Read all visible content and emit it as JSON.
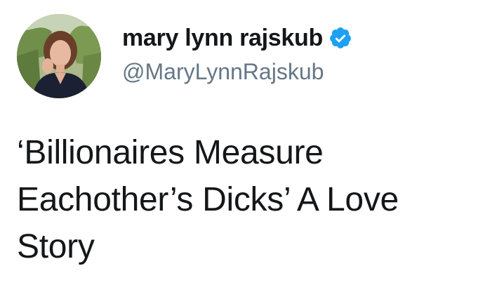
{
  "tweet": {
    "author": {
      "display_name": "mary lynn rajskub",
      "handle": "@MaryLynnRajskub",
      "verified": true
    },
    "text": "‘Billionaires Measure Eachother’s Dicks’ A Love Story"
  },
  "icons": {
    "avatar": "profile-photo",
    "verified": "verified-badge-icon"
  },
  "colors": {
    "text_primary": "#14171a",
    "text_secondary": "#657786",
    "verified_blue": "#1da1f2",
    "background": "#ffffff"
  }
}
